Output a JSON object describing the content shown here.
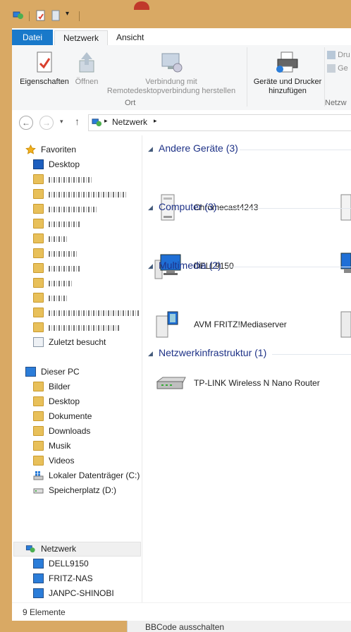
{
  "ribbon_tabs": [
    "Datei",
    "Netzwerk",
    "Ansicht"
  ],
  "ribbon": {
    "eigenschaften": "Eigenschaften",
    "oeffnen": "Öffnen",
    "remote_line1": "Verbindung mit",
    "remote_line2": "Remotedesktopverbindung herstellen",
    "group_ort": "Ort",
    "geraete_line1": "Geräte und Drucker",
    "geraete_line2": "hinzufügen",
    "dru": "Dru",
    "ge": "Ge",
    "group_netzw": "Netzw"
  },
  "address": {
    "path": "Netzwerk"
  },
  "nav": {
    "favoriten": "Favoriten",
    "desktop": "Desktop",
    "zuletzt": "Zuletzt besucht",
    "dieser_pc": "Dieser PC",
    "pc_items": [
      "Bilder",
      "Desktop",
      "Dokumente",
      "Downloads",
      "Musik",
      "Videos",
      "Lokaler Datenträger (C:)",
      "Speicherplatz (D:)"
    ],
    "netzwerk": "Netzwerk",
    "net_items": [
      "DELL9150",
      "FRITZ-NAS",
      "JANPC-SHINOBI"
    ]
  },
  "groups": [
    {
      "title": "Andere Geräte (3)",
      "item": "Chromecast4243"
    },
    {
      "title": "Computer (3)",
      "item": "DELL9150"
    },
    {
      "title": "Multimedia (2)",
      "item": "AVM FRITZ!Mediaserver"
    },
    {
      "title": "Netzwerkinfrastruktur (1)",
      "item": "TP-LINK Wireless N Nano Router"
    }
  ],
  "status": {
    "count": "9 Elemente"
  },
  "behind": {
    "text": "BBCode ausschalten"
  }
}
